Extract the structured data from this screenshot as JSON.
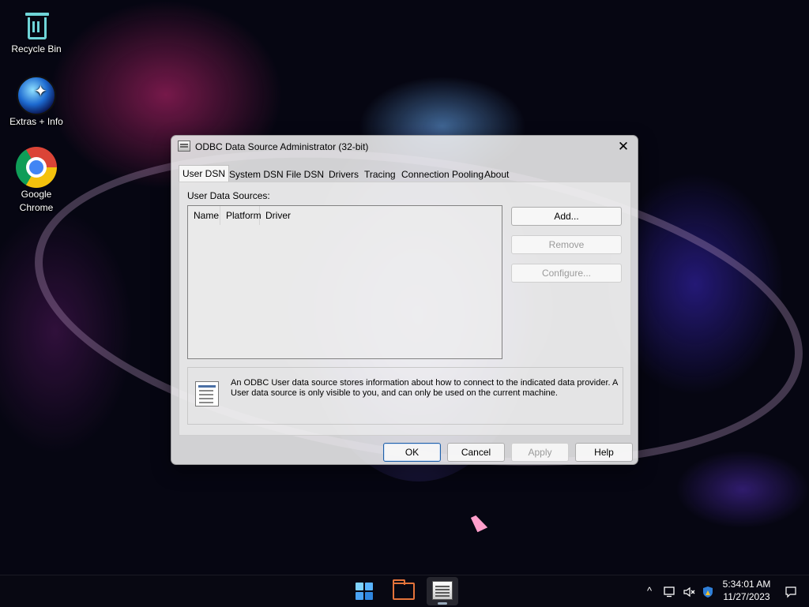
{
  "desktop": {
    "icons": [
      {
        "label": "Recycle Bin",
        "icon": "recycle-bin-icon"
      },
      {
        "label": "Extras + Info",
        "icon": "extras-info-icon"
      },
      {
        "label": "Google Chrome",
        "icon": "chrome-icon"
      }
    ]
  },
  "dialog": {
    "title": "ODBC Data Source Administrator (32-bit)",
    "close_glyph": "✕",
    "tabs": [
      {
        "label": "User DSN",
        "active": true
      },
      {
        "label": "System DSN"
      },
      {
        "label": "File DSN"
      },
      {
        "label": "Drivers"
      },
      {
        "label": "Tracing"
      },
      {
        "label": "Connection Pooling"
      },
      {
        "label": "About"
      }
    ],
    "sources_label": "User Data Sources:",
    "columns": [
      "Name",
      "Platform",
      "Driver"
    ],
    "rows": [],
    "side_buttons": {
      "add": "Add...",
      "remove": "Remove",
      "configure": "Configure..."
    },
    "info_text": "An ODBC User data source stores information about how to connect to the indicated data provider.   A User data source is only visible to you, and can only be used on the current machine.",
    "footer_buttons": {
      "ok": "OK",
      "cancel": "Cancel",
      "apply": "Apply",
      "help": "Help"
    }
  },
  "taskbar": {
    "apps": [
      "start-icon",
      "file-explorer-icon",
      "odbc-admin-icon"
    ],
    "tray": {
      "chevron": "^",
      "network": "network-icon",
      "volume": "volume-muted-icon",
      "security": "windows-security-icon"
    },
    "time": "5:34:01 AM",
    "date": "11/27/2023"
  }
}
